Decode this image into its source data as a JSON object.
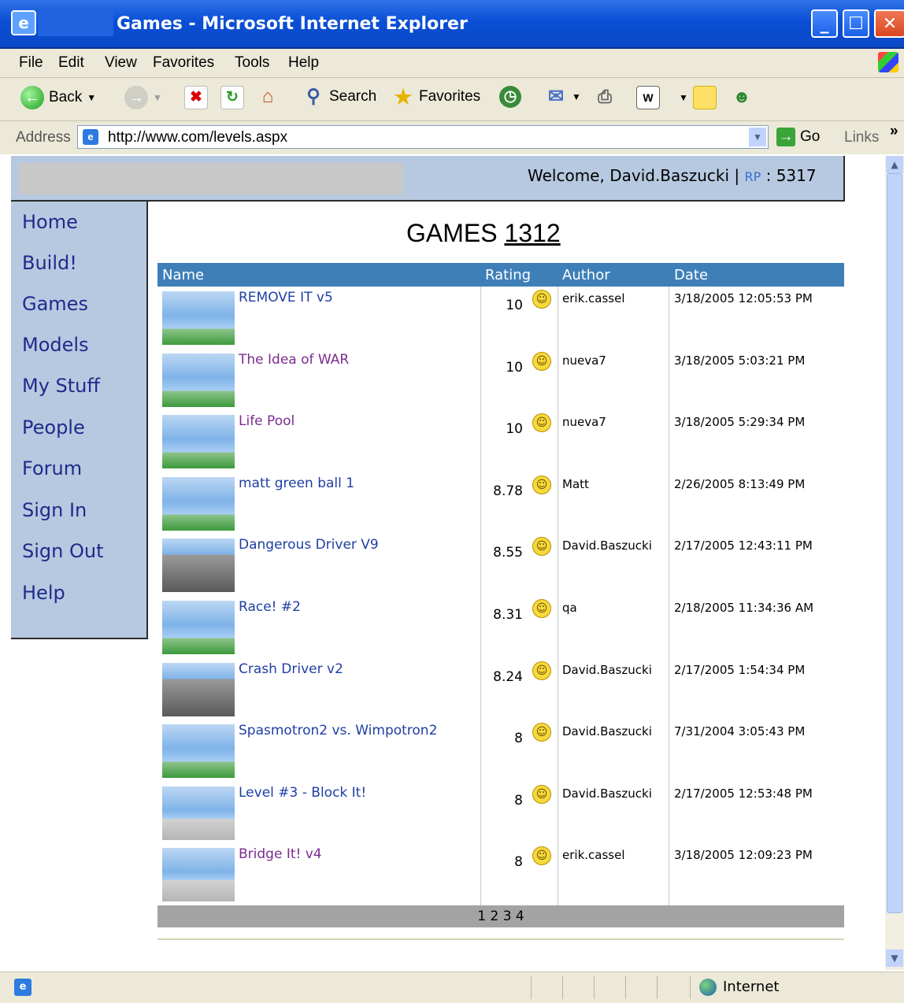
{
  "window": {
    "title": "Games - Microsoft Internet Explorer",
    "min": "_",
    "max": "☐",
    "close": "✕"
  },
  "menu": [
    "File",
    "Edit",
    "View",
    "Favorites",
    "Tools",
    "Help"
  ],
  "toolbar": {
    "back": "Back",
    "search": "Search",
    "favorites": "Favorites"
  },
  "address": {
    "label": "Address",
    "url": "http://www.com/levels.aspx",
    "go": "Go",
    "links": "Links",
    "more": "»"
  },
  "header": {
    "welcome": "Welcome, David.Baszucki |",
    "rp_label": "RP",
    "rp_sep": ":",
    "rp_value": "5317"
  },
  "nav": [
    "Home",
    "Build!",
    "Games",
    "Models",
    "My Stuff",
    "People",
    "Forum",
    "Sign In",
    "Sign Out",
    "Help"
  ],
  "page": {
    "title": "GAMES",
    "count": "1312"
  },
  "table": {
    "headers": [
      "Name",
      "Rating",
      "Author",
      "Date"
    ],
    "rows": [
      {
        "name": "REMOVE IT v5",
        "rating": "10",
        "author": "erik.cassel",
        "date": "3/18/2005 12:05:53 PM",
        "link": "blue",
        "thumb": "normal"
      },
      {
        "name": "The Idea of WAR",
        "rating": "10",
        "author": "nueva7",
        "date": "3/18/2005 5:03:21 PM",
        "link": "purple",
        "thumb": "normal"
      },
      {
        "name": "Life Pool",
        "rating": "10",
        "author": "nueva7",
        "date": "3/18/2005 5:29:34 PM",
        "link": "purple",
        "thumb": "normal"
      },
      {
        "name": "matt green ball 1",
        "rating": "8.78",
        "author": "Matt",
        "date": "2/26/2005 8:13:49 PM",
        "link": "blue",
        "thumb": "normal"
      },
      {
        "name": "Dangerous Driver V9",
        "rating": "8.55",
        "author": "David.Baszucki",
        "date": "2/17/2005 12:43:11 PM",
        "link": "blue",
        "thumb": "dark"
      },
      {
        "name": "Race! #2",
        "rating": "8.31",
        "author": "qa",
        "date": "2/18/2005 11:34:36 AM",
        "link": "blue",
        "thumb": "normal"
      },
      {
        "name": "Crash Driver v2",
        "rating": "8.24",
        "author": "David.Baszucki",
        "date": "2/17/2005 1:54:34 PM",
        "link": "blue",
        "thumb": "dark"
      },
      {
        "name": "Spasmotron2 vs. Wimpotron2",
        "rating": "8",
        "author": "David.Baszucki",
        "date": "7/31/2004 3:05:43 PM",
        "link": "blue",
        "thumb": "normal"
      },
      {
        "name": "Level #3 - Block It!",
        "rating": "8",
        "author": "David.Baszucki",
        "date": "2/17/2005 12:53:48 PM",
        "link": "blue",
        "thumb": "gray"
      },
      {
        "name": "Bridge It! v4",
        "rating": "8",
        "author": "erik.cassel",
        "date": "3/18/2005 12:09:23 PM",
        "link": "purple",
        "thumb": "gray"
      }
    ]
  },
  "pager": "1 2 3 4",
  "status": {
    "zone": "Internet"
  },
  "icons": {
    "rating": "smiley-icon",
    "back": "back-arrow-icon",
    "search": "search-icon",
    "favorites": "star-icon"
  }
}
